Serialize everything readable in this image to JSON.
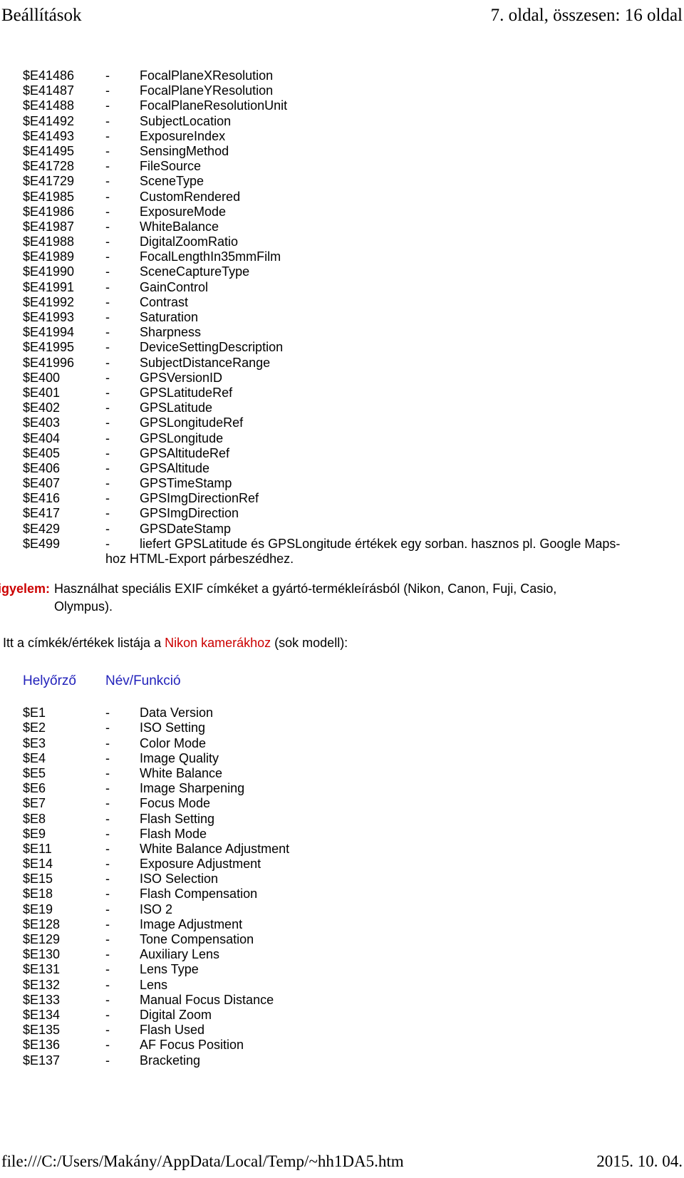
{
  "header": {
    "title": "Beállítások",
    "page_info": "7. oldal, összesen: 16 oldal"
  },
  "exif_section": {
    "separator": "-",
    "rows": [
      {
        "code": "$E41486",
        "name": "FocalPlaneXResolution"
      },
      {
        "code": "$E41487",
        "name": "FocalPlaneYResolution"
      },
      {
        "code": "$E41488",
        "name": "FocalPlaneResolutionUnit"
      },
      {
        "code": "$E41492",
        "name": "SubjectLocation"
      },
      {
        "code": "$E41493",
        "name": "ExposureIndex"
      },
      {
        "code": "$E41495",
        "name": "SensingMethod"
      },
      {
        "code": "$E41728",
        "name": "FileSource"
      },
      {
        "code": "$E41729",
        "name": "SceneType"
      },
      {
        "code": "$E41985",
        "name": "CustomRendered"
      },
      {
        "code": "$E41986",
        "name": "ExposureMode"
      },
      {
        "code": "$E41987",
        "name": "WhiteBalance"
      },
      {
        "code": "$E41988",
        "name": "DigitalZoomRatio"
      },
      {
        "code": "$E41989",
        "name": "FocalLengthIn35mmFilm"
      },
      {
        "code": "$E41990",
        "name": "SceneCaptureType"
      },
      {
        "code": "$E41991",
        "name": "GainControl"
      },
      {
        "code": "$E41992",
        "name": "Contrast"
      },
      {
        "code": "$E41993",
        "name": "Saturation"
      },
      {
        "code": "$E41994",
        "name": "Sharpness"
      },
      {
        "code": "$E41995",
        "name": "DeviceSettingDescription"
      },
      {
        "code": "$E41996",
        "name": "SubjectDistanceRange"
      },
      {
        "code": "$E400",
        "name": "GPSVersionID"
      },
      {
        "code": "$E401",
        "name": "GPSLatitudeRef"
      },
      {
        "code": "$E402",
        "name": "GPSLatitude"
      },
      {
        "code": "$E403",
        "name": "GPSLongitudeRef"
      },
      {
        "code": "$E404",
        "name": "GPSLongitude"
      },
      {
        "code": "$E405",
        "name": "GPSAltitudeRef"
      },
      {
        "code": "$E406",
        "name": "GPSAltitude"
      },
      {
        "code": "$E407",
        "name": "GPSTimeStamp"
      },
      {
        "code": "$E416",
        "name": "GPSImgDirectionRef"
      },
      {
        "code": "$E417",
        "name": "GPSImgDirection"
      },
      {
        "code": "$E429",
        "name": "GPSDateStamp"
      },
      {
        "code": "$E499",
        "name": "liefert GPSLatitude és GPSLongitude értékek egy sorban. hasznos pl. Google Maps-"
      }
    ],
    "last_row_continuation": "hoz  HTML-Export párbeszédhez."
  },
  "warning": {
    "label": "Figyelem:",
    "line1": "Használhat speciális EXIF címkéket a gyártó-termékleírásból (Nikon, Canon, Fuji, Casio,",
    "line2": "Olympus)."
  },
  "intro": {
    "before": "Itt a címkék/értékek listája a ",
    "highlight": "Nikon kamerákhoz",
    "after": " (sok modell):"
  },
  "nikon_section": {
    "col_header_1": "Helyőrző",
    "col_header_2": "Név/Funkció",
    "separator": "-",
    "rows": [
      {
        "code": "$E1",
        "name": "Data Version"
      },
      {
        "code": "$E2",
        "name": "ISO Setting"
      },
      {
        "code": "$E3",
        "name": "Color Mode"
      },
      {
        "code": "$E4",
        "name": "Image Quality"
      },
      {
        "code": "$E5",
        "name": "White Balance"
      },
      {
        "code": "$E6",
        "name": "Image Sharpening"
      },
      {
        "code": "$E7",
        "name": "Focus Mode"
      },
      {
        "code": "$E8",
        "name": "Flash Setting"
      },
      {
        "code": "$E9",
        "name": "Flash Mode"
      },
      {
        "code": "$E11",
        "name": "White Balance Adjustment"
      },
      {
        "code": "$E14",
        "name": "Exposure Adjustment"
      },
      {
        "code": "$E15",
        "name": "ISO Selection"
      },
      {
        "code": "$E18",
        "name": "Flash Compensation"
      },
      {
        "code": "$E19",
        "name": "ISO 2"
      },
      {
        "code": "$E128",
        "name": "Image Adjustment"
      },
      {
        "code": "$E129",
        "name": "Tone Compensation"
      },
      {
        "code": "$E130",
        "name": "Auxiliary Lens"
      },
      {
        "code": "$E131",
        "name": "Lens Type"
      },
      {
        "code": "$E132",
        "name": "Lens"
      },
      {
        "code": "$E133",
        "name": "Manual Focus Distance"
      },
      {
        "code": "$E134",
        "name": "Digital Zoom"
      },
      {
        "code": "$E135",
        "name": "Flash Used"
      },
      {
        "code": "$E136",
        "name": "AF Focus Position"
      },
      {
        "code": "$E137",
        "name": "Bracketing"
      }
    ]
  },
  "footer": {
    "path": "file:///C:/Users/Makány/AppData/Local/Temp/~hh1DA5.htm",
    "date": "2015. 10. 04."
  },
  "colors": {
    "accent_red": "#cc0000",
    "accent_blue": "#2222bb",
    "text": "#000000",
    "background": "#ffffff"
  }
}
